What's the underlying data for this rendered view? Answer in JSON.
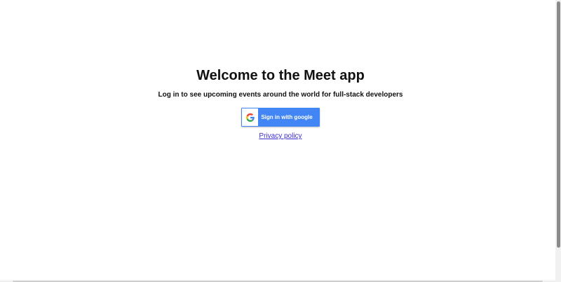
{
  "page": {
    "title": "Welcome to the Meet app",
    "subtitle": "Log in to see upcoming events around the world for full-stack developers"
  },
  "google_button": {
    "label": "Sign in with google",
    "icon": "google-g-icon",
    "brand_color": "#4285f4"
  },
  "privacy": {
    "link_text": "Privacy policy",
    "link_color": "#3b2cd6"
  }
}
